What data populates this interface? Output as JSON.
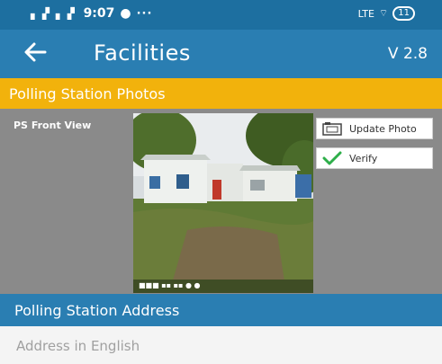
{
  "status_bar": {
    "time": "9:07",
    "signal": "▖▗▘ ▖▗▘",
    "dots": "···",
    "network": "LTE",
    "battery": "11"
  },
  "app_bar": {
    "title": "Facilities",
    "version": "V 2.8"
  },
  "photos_section": {
    "title": "Polling Station Photos",
    "photo_label": "PS Front View",
    "update_button": "Update Photo",
    "verify_button": "Verify"
  },
  "address_section": {
    "title": "Polling Station Address",
    "address_placeholder": "Address in English"
  },
  "colors": {
    "primary": "#2a7eb2",
    "accent": "#f2b20c",
    "verify_check": "#2eae4a"
  }
}
